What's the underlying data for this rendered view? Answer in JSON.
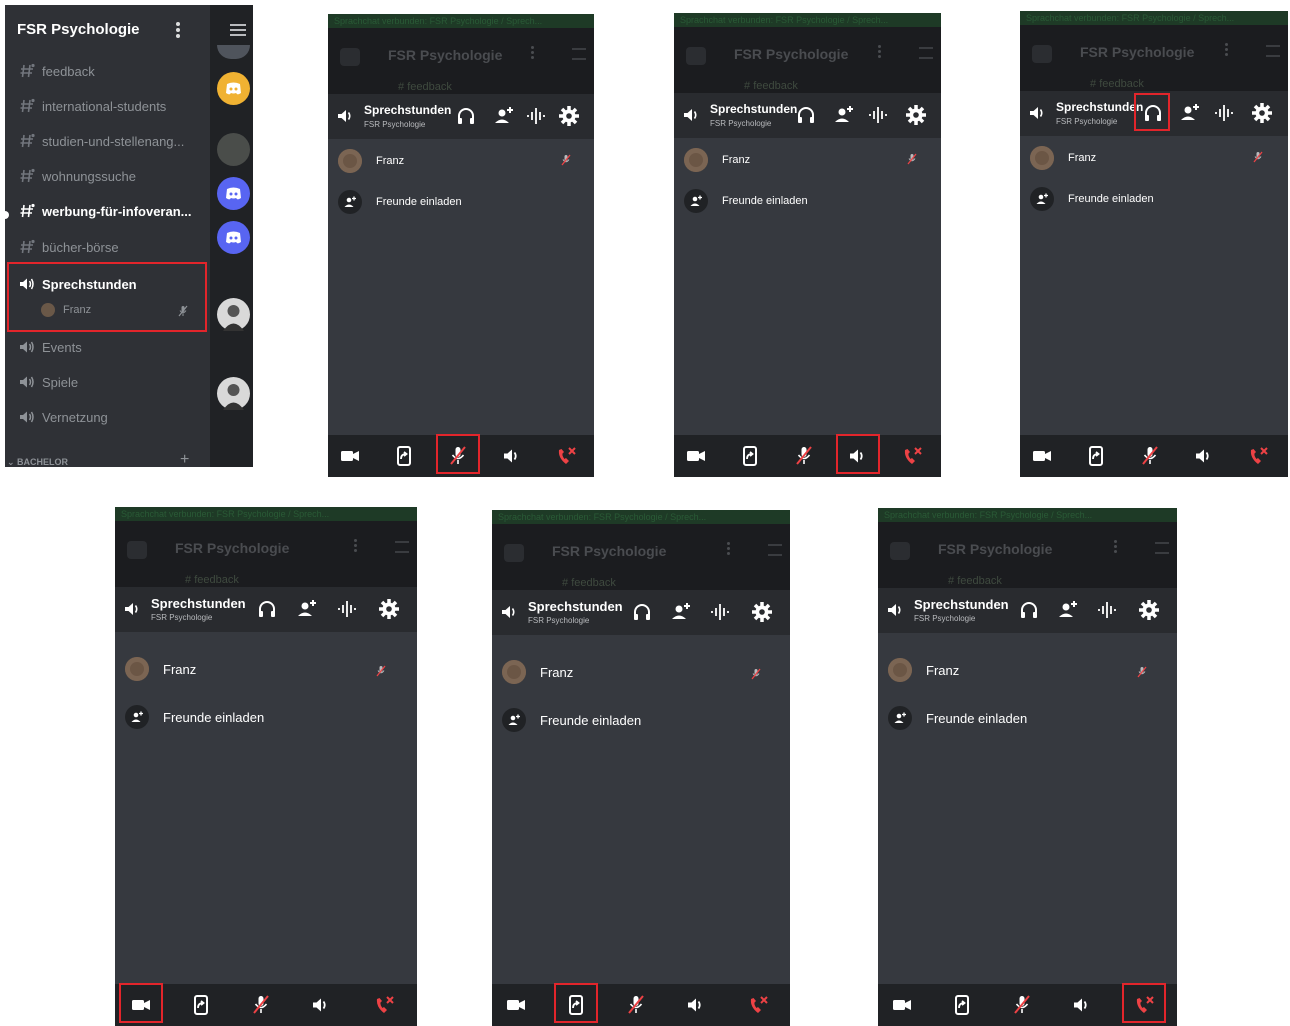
{
  "channel_list": {
    "server_name": "FSR Psychologie",
    "text_channels": [
      {
        "label": "feedback",
        "bold": false
      },
      {
        "label": "international-students",
        "bold": false
      },
      {
        "label": "studien-und-stellenang...",
        "bold": false
      },
      {
        "label": "wohnungssuche",
        "bold": false
      },
      {
        "label": "werbung-für-infoveran...",
        "bold": true
      },
      {
        "label": "bücher-börse",
        "bold": false
      }
    ],
    "voice_selected": {
      "label": "Sprechstunden",
      "user": "Franz"
    },
    "voice_channels": [
      {
        "label": "Events"
      },
      {
        "label": "Spiele"
      },
      {
        "label": "Vernetzung"
      }
    ],
    "category": "BACHELOR",
    "rail_colors": [
      "#f0b232",
      "#5865f2",
      "#5865f2"
    ]
  },
  "voice_panel": {
    "banner": "Sprachchat verbunden: FSR Psychologie / Sprech...",
    "bg_server_name": "FSR Psychologie",
    "bg_channel": "feedback",
    "channel_title": "Sprechstunden",
    "channel_subtitle": "FSR Psychologie",
    "user_name": "Franz",
    "invite_label": "Freunde einladen",
    "header_icons": [
      "headphones-icon",
      "add-user-icon",
      "voice-activity-icon",
      "settings-icon"
    ],
    "bottom_icons": [
      "video-icon",
      "screen-share-icon",
      "microphone-muted-icon",
      "speaker-icon",
      "disconnect-icon"
    ]
  },
  "highlights": [
    "microphone-muted-icon",
    "speaker-icon",
    "headphones-icon",
    "video-icon",
    "screen-share-icon",
    "disconnect-icon"
  ],
  "colors": {
    "accent_red": "#e2252b",
    "panel_bg": "#36393f",
    "bar_bg": "#202225",
    "disconnect": "#ed4245"
  }
}
